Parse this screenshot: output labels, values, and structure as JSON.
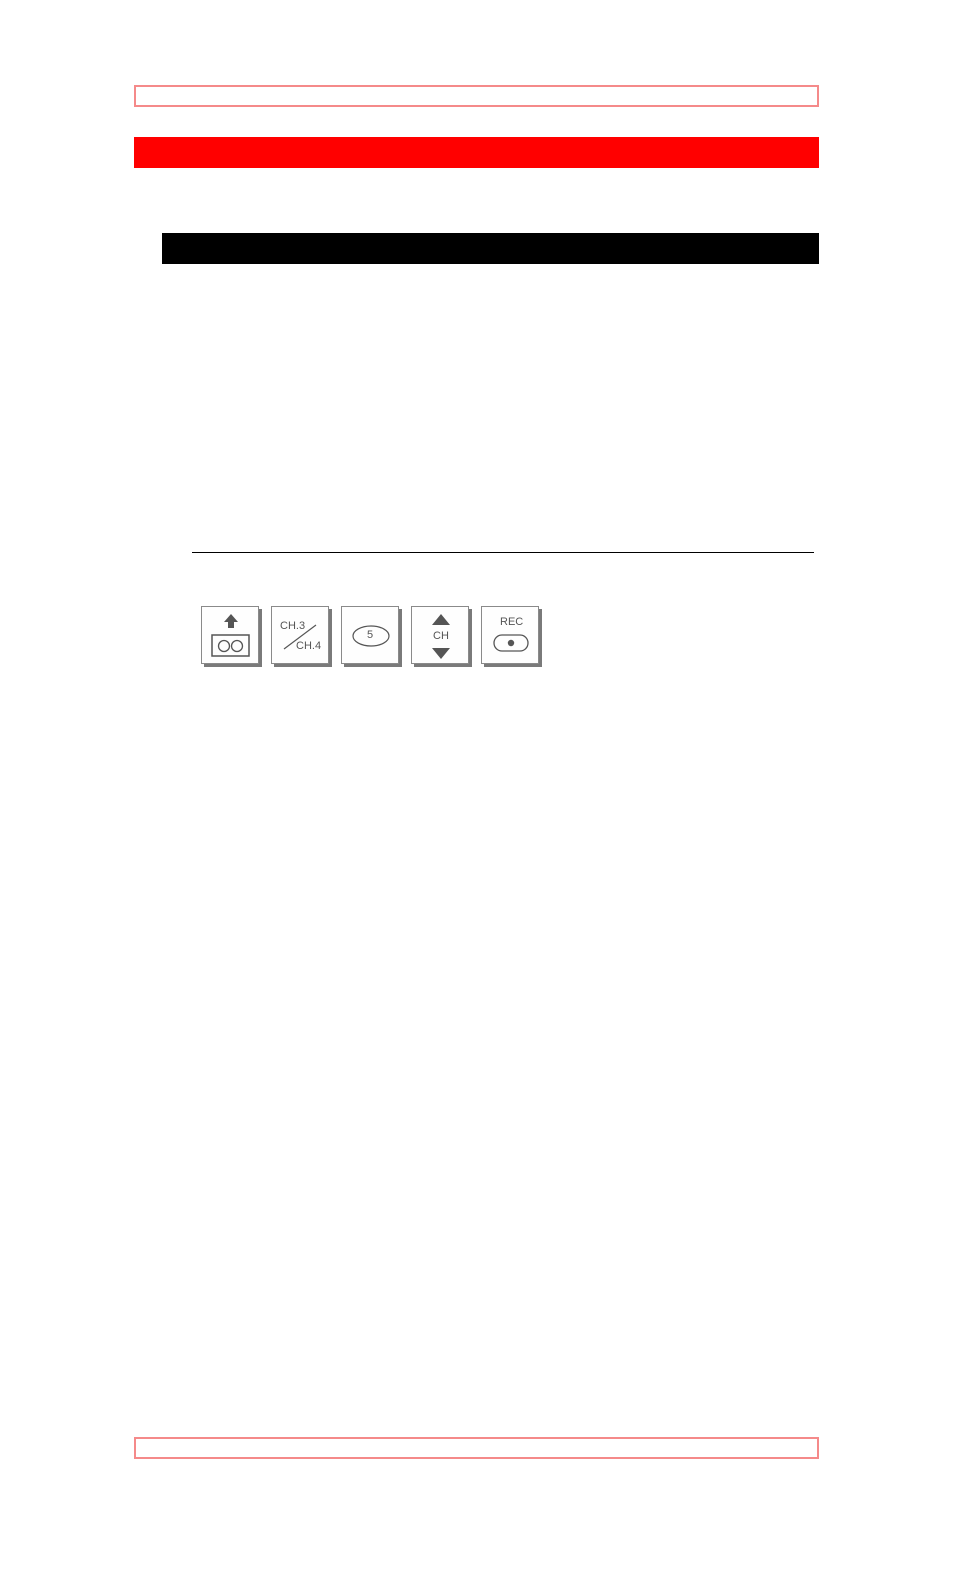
{
  "colors": {
    "frame": "#f58a8a",
    "section_bar": "#ff0000",
    "subsection_bar": "#000000",
    "rule": "#000000",
    "button_ink": "#555555"
  },
  "header": {
    "section_title": "",
    "subsection_title": ""
  },
  "buttons": [
    {
      "name": "eject",
      "icon": "eject-cassette-icon",
      "label": ""
    },
    {
      "name": "ch3-ch4",
      "icon": "ch3-ch4-switch-icon",
      "label_top": "CH.3",
      "label_bottom": "CH.4"
    },
    {
      "name": "number-5",
      "icon": "number-key-icon",
      "label": "5"
    },
    {
      "name": "channel",
      "icon": "channel-up-down-icon",
      "label": "CH"
    },
    {
      "name": "record",
      "icon": "record-icon",
      "label": "REC"
    }
  ]
}
